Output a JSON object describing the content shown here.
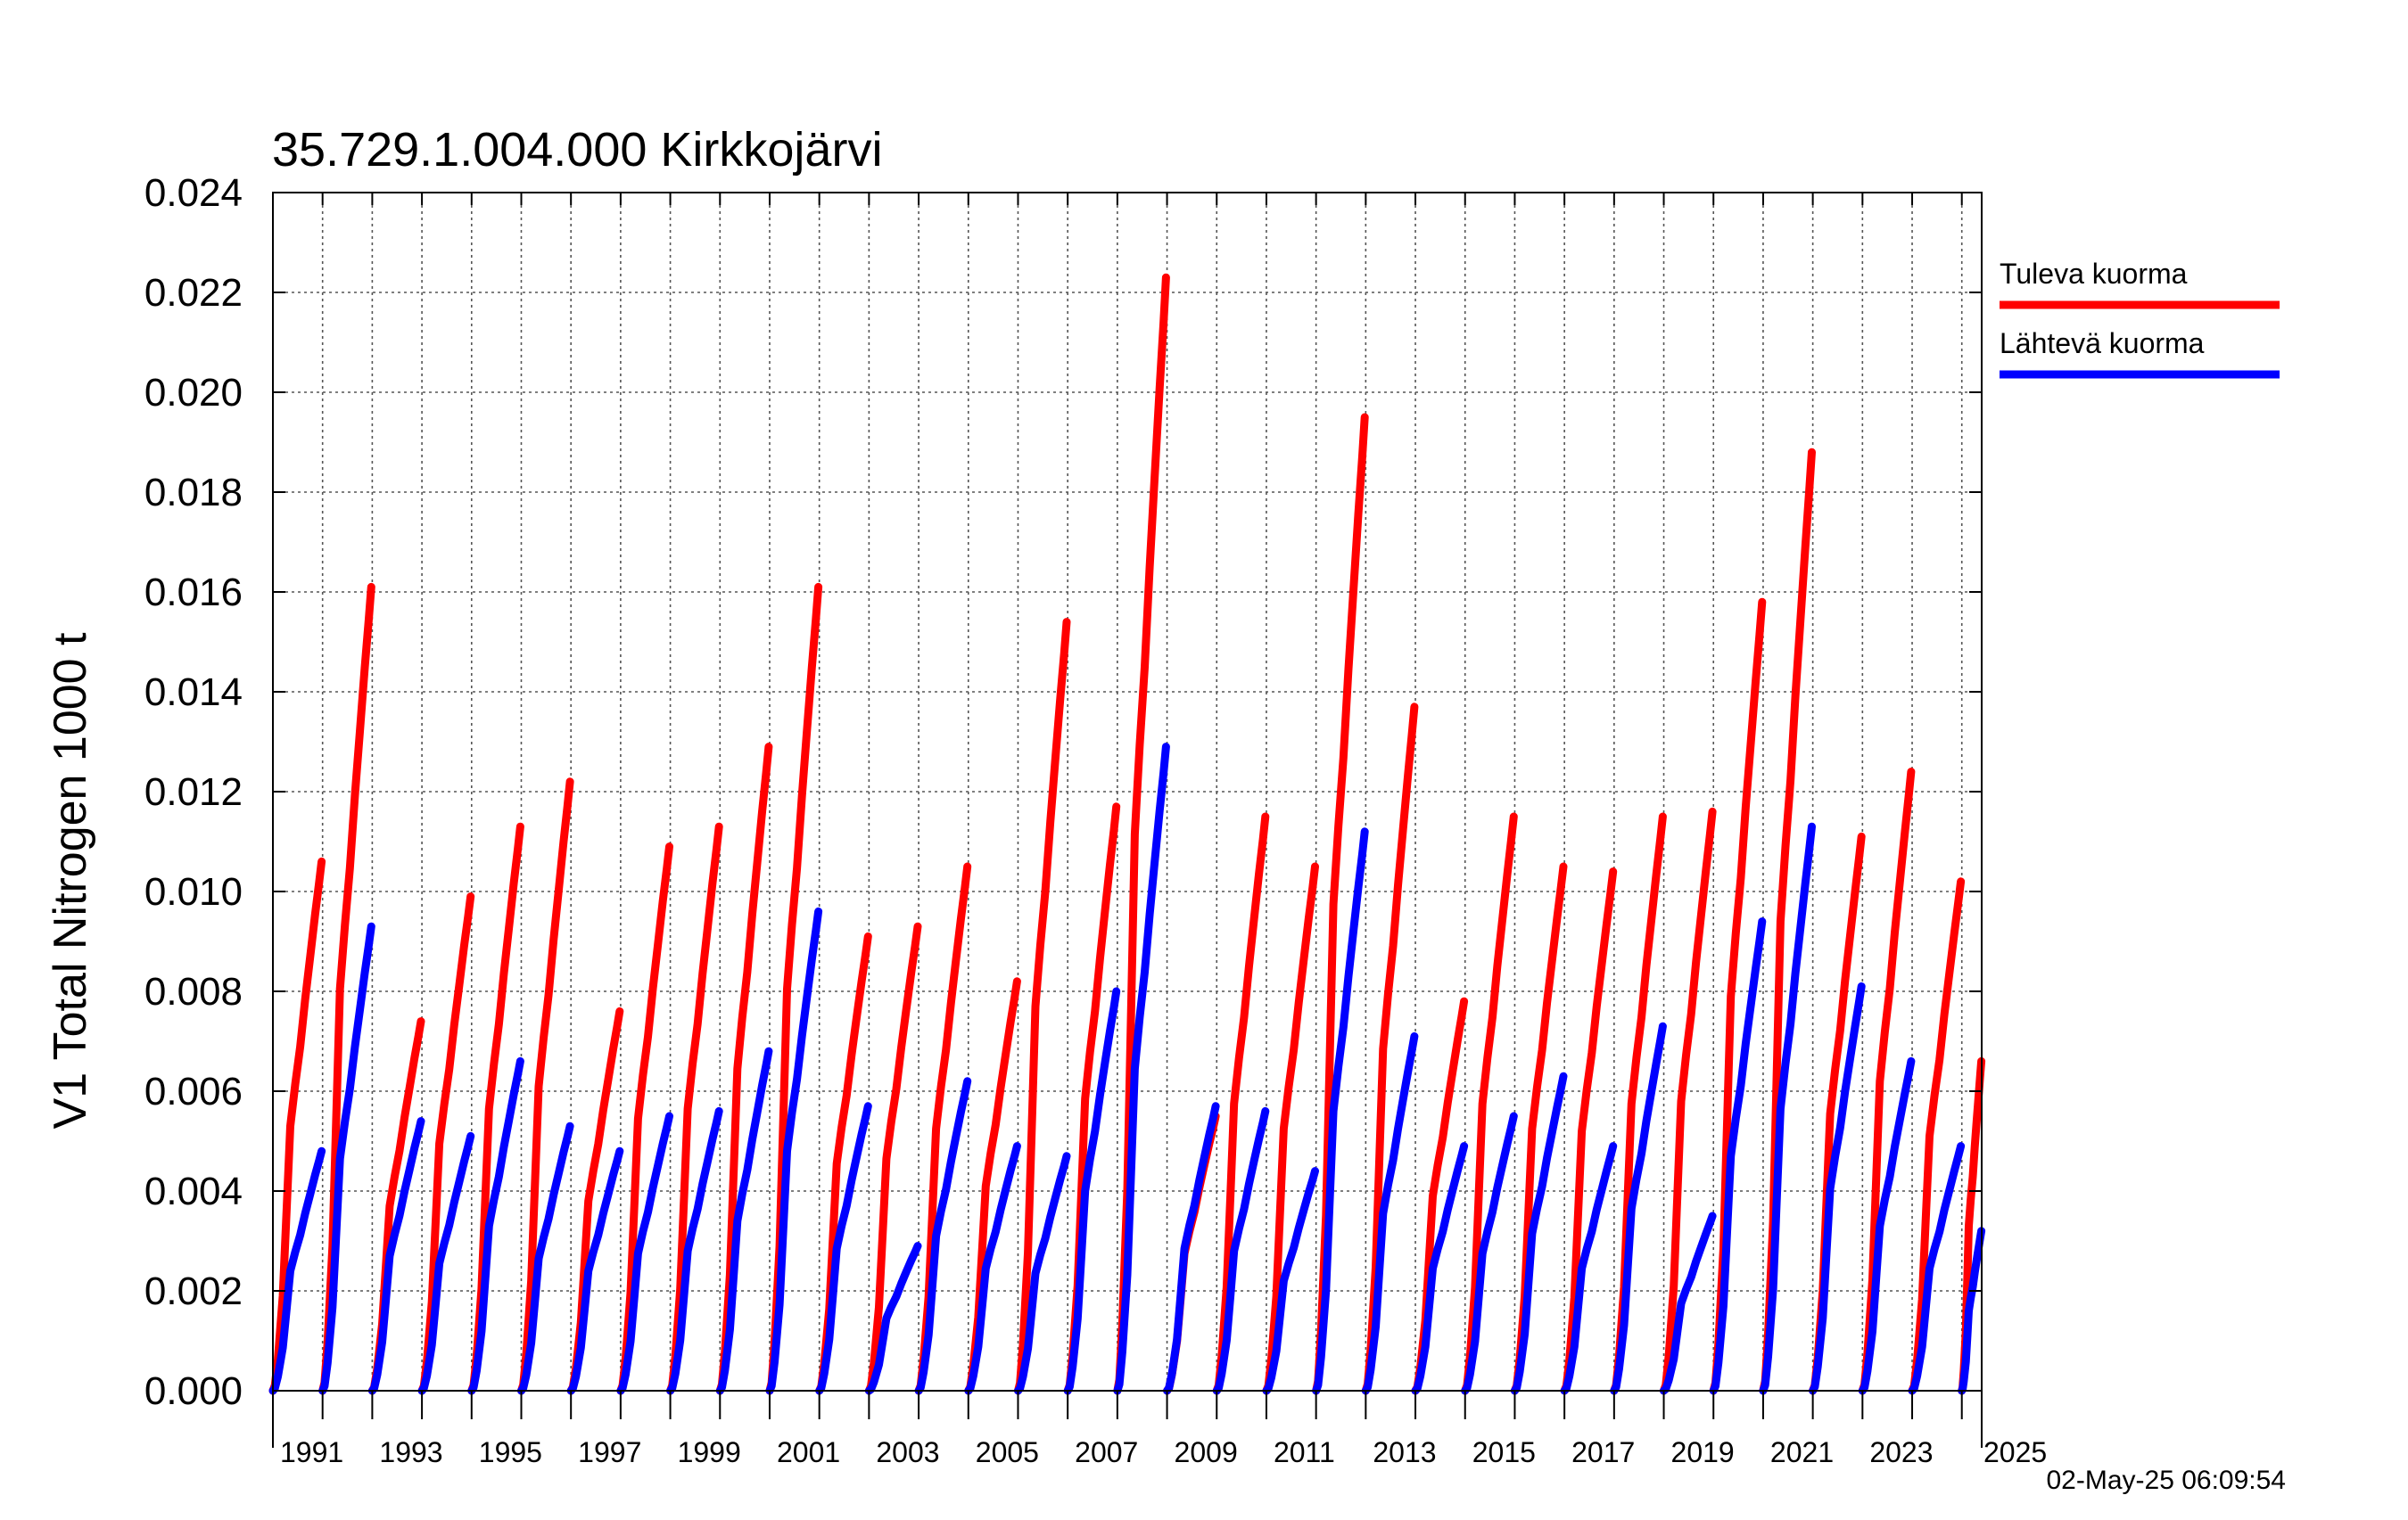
{
  "chart_data": {
    "type": "line",
    "title": "35.729.1.004.000 Kirkkojärvi",
    "ylabel": "V1 Total Nitrogen 1000 t",
    "xlabel": "",
    "timestamp": "02-May-25 06:09:54",
    "xlim": [
      1990,
      2024.4
    ],
    "ylim": [
      0,
      0.024
    ],
    "y_ticks": [
      "0.000",
      "0.002",
      "0.004",
      "0.006",
      "0.008",
      "0.010",
      "0.012",
      "0.014",
      "0.016",
      "0.018",
      "0.020",
      "0.022",
      "0.024"
    ],
    "x_tick_labels": [
      "1991",
      "1993",
      "1995",
      "1997",
      "1999",
      "2001",
      "2003",
      "2005",
      "2007",
      "2009",
      "2011",
      "2013",
      "2015",
      "2017",
      "2019",
      "2021",
      "2023",
      "2025"
    ],
    "grid": true,
    "legend_position": "right",
    "series": [
      {
        "name": "Tuleva kuorma",
        "color": "#ff0000",
        "end_values": [
          0.0106,
          0.0161,
          0.0074,
          0.0099,
          0.0113,
          0.0122,
          0.0076,
          0.0109,
          0.0113,
          0.0129,
          0.0161,
          0.0091,
          0.0093,
          0.0105,
          0.0082,
          0.0154,
          0.0117,
          0.0223,
          0.0055,
          0.0115,
          0.0105,
          0.0195,
          0.0137,
          0.0078,
          0.0115,
          0.0105,
          0.0104,
          0.0115,
          0.0116,
          0.0158,
          0.0188,
          0.0111,
          0.0124,
          0.0102,
          0.0066
        ]
      },
      {
        "name": "Lähtevä kuorma",
        "color": "#0000ff",
        "end_values": [
          0.0048,
          0.0093,
          0.0054,
          0.0051,
          0.0066,
          0.0053,
          0.0048,
          0.0055,
          0.0056,
          0.0068,
          0.0096,
          0.0057,
          0.0029,
          0.0062,
          0.0049,
          0.0047,
          0.008,
          0.0129,
          0.0057,
          0.0056,
          0.0044,
          0.0112,
          0.0071,
          0.0049,
          0.0055,
          0.0063,
          0.0049,
          0.0073,
          0.0035,
          0.0094,
          0.0113,
          0.0081,
          0.0066,
          0.0049,
          0.0032
        ]
      }
    ]
  }
}
